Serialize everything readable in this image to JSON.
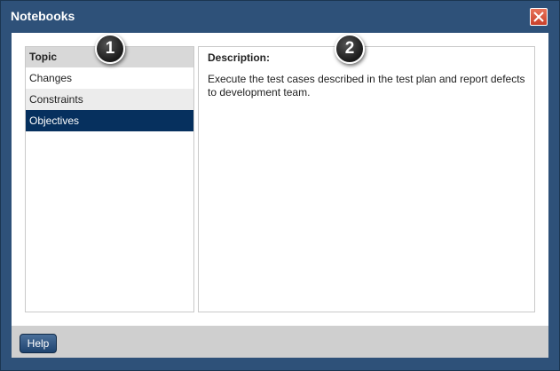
{
  "window": {
    "title": "Notebooks",
    "close_icon": "close-x-icon"
  },
  "topic_panel": {
    "header": "Topic",
    "items": [
      {
        "label": "Changes",
        "selected": false
      },
      {
        "label": "Constraints",
        "selected": false
      },
      {
        "label": "Objectives",
        "selected": true
      }
    ]
  },
  "description_panel": {
    "label": "Description:",
    "text": "Execute the test cases described in the test plan and report defects to development team."
  },
  "callouts": [
    "1",
    "2"
  ],
  "footer": {
    "help_label": "Help"
  },
  "colors": {
    "titlebar": "#2e5179",
    "selected_row": "#06305e",
    "close_button": "#d9553c"
  }
}
